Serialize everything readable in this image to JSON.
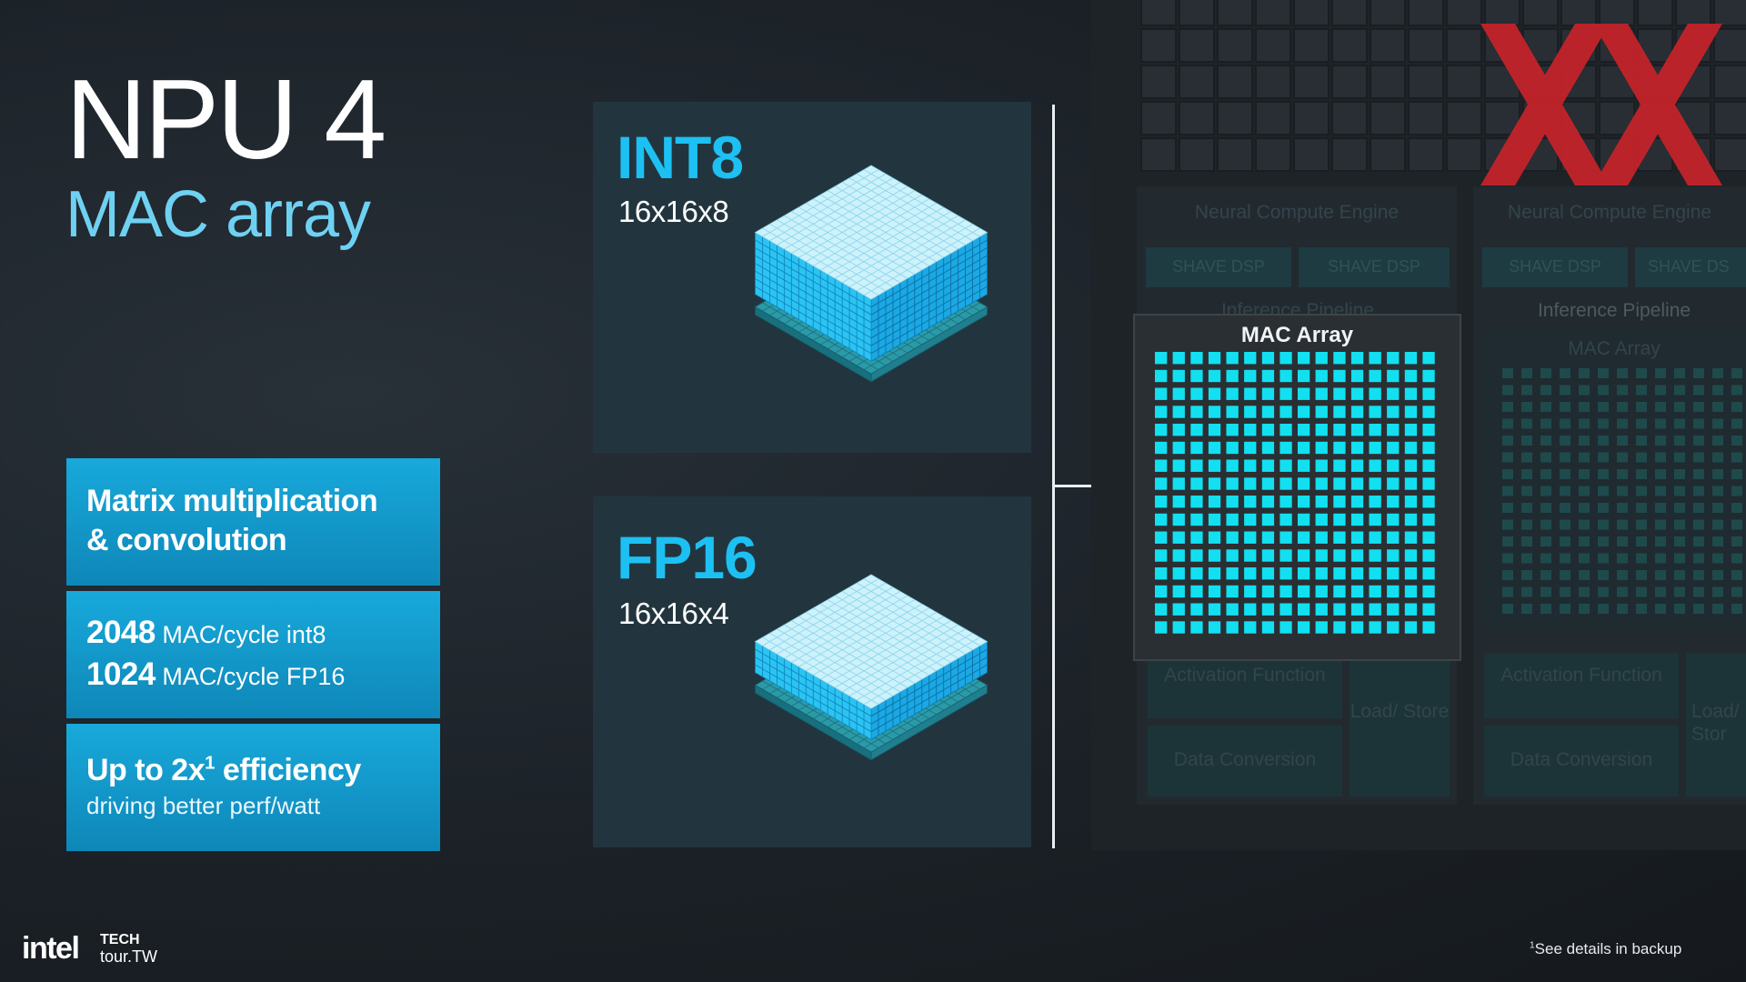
{
  "slide": {
    "title": "NPU 4",
    "subtitle": "MAC array"
  },
  "features": {
    "box1": {
      "line1": "Matrix multiplication",
      "line2": "& convolution"
    },
    "box2": {
      "row1_value": "2048",
      "row1_unit": "MAC/cycle int8",
      "row2_value": "1024",
      "row2_unit": "MAC/cycle FP16"
    },
    "box3": {
      "heading_pre": "Up to 2x",
      "heading_sup": "1",
      "heading_post": " efficiency",
      "sub": "driving better perf/watt"
    }
  },
  "panels": {
    "int8": {
      "label": "INT8",
      "dims": "16x16x8",
      "layers": 8
    },
    "fp16": {
      "label": "FP16",
      "dims": "16x16x4",
      "layers": 4
    }
  },
  "block_diagram": {
    "highlight_title": "MAC Array",
    "highlight_grid": {
      "rows": 16,
      "cols": 16
    },
    "nce_title": "Neural Compute Engine",
    "nce_title_2": "Neural Compute Engine",
    "shave1": "SHAVE DSP",
    "shave2": "SHAVE DSP",
    "shave3": "SHAVE DSP",
    "shave4": "SHAVE DS",
    "pipeline1": "Inference Pipeline",
    "pipeline2": "Inference Pipeline",
    "mac2": "MAC Array",
    "act1": "Activation Function",
    "act2": "Activation Function",
    "load1": "Load/ Store",
    "load2": "Load/ Stor",
    "conv1": "Data Conversion",
    "conv2": "Data Conversion"
  },
  "footer": {
    "brand": "intel",
    "event_line1": "TECH",
    "event_line2": "tour.TW",
    "footnote_sup": "1",
    "footnote": "See details in backup"
  },
  "colors": {
    "accent_cyan": "#1dc0f2",
    "subtitle_cyan": "#6fd1f2",
    "box_blue": "#0e87b8",
    "mac_cell": "#12e0f0",
    "watermark_red": "#c8232a"
  }
}
